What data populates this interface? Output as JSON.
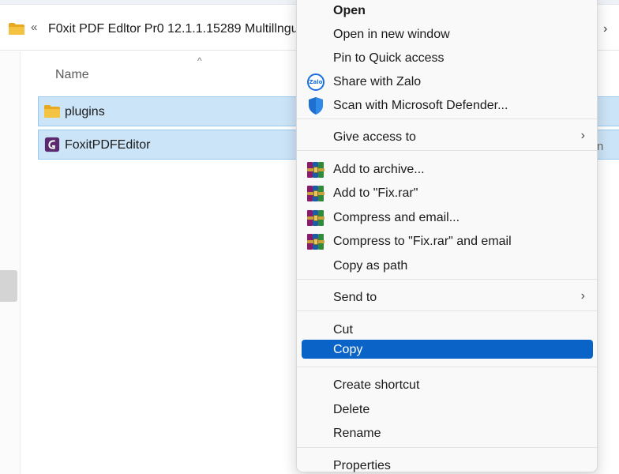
{
  "address_bar": {
    "back_glyph": "«",
    "path": "F0xit PDF Edltor Pr0 12.1.1.15289 Multillngu",
    "right_glyph": "›"
  },
  "file_list": {
    "sort_indicator": "^",
    "column_name": "Name",
    "items": [
      {
        "name": "plugins",
        "icon": "folder-icon"
      },
      {
        "name": "FoxitPDFEditor",
        "icon": "foxit-app-icon"
      }
    ],
    "clipped_column_text": "n"
  },
  "context_menu": {
    "items": [
      {
        "label": "Open",
        "bold": true
      },
      {
        "label": "Open in new window"
      },
      {
        "label": "Pin to Quick access"
      },
      {
        "label": "Share with Zalo",
        "icon": "zalo-icon"
      },
      {
        "label": "Scan with Microsoft Defender...",
        "icon": "defender-shield-icon"
      },
      {
        "label": "Give access to",
        "submenu": true
      },
      {
        "label": "Add to archive...",
        "icon": "winrar-icon"
      },
      {
        "label": "Add to \"Fix.rar\"",
        "icon": "winrar-icon"
      },
      {
        "label": "Compress and email...",
        "icon": "winrar-icon"
      },
      {
        "label": "Compress to \"Fix.rar\" and email",
        "icon": "winrar-icon"
      },
      {
        "label": "Copy as path"
      },
      {
        "label": "Send to",
        "submenu": true
      },
      {
        "label": "Cut"
      },
      {
        "label": "Copy",
        "highlighted": true
      },
      {
        "label": "Create shortcut"
      },
      {
        "label": "Delete"
      },
      {
        "label": "Rename"
      },
      {
        "label": "Properties"
      }
    ],
    "submenu_glyph": "›",
    "zalo_text": "Zalo"
  },
  "colors": {
    "selection_bg": "#cce4f7",
    "selection_border": "#99c9ef",
    "menu_highlight": "#0a64c8",
    "folder_yellow": "#f5c342"
  }
}
